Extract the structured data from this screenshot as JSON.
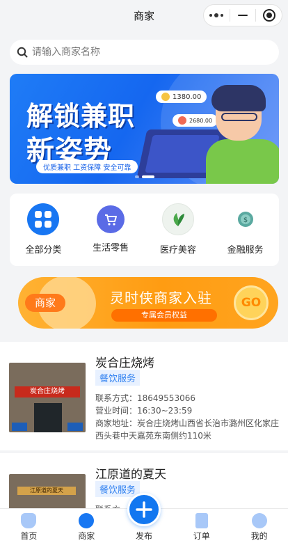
{
  "header": {
    "title": "商家"
  },
  "search": {
    "placeholder": "请输入商家名称"
  },
  "banner": {
    "headline1": "解锁兼职",
    "headline2": "新姿势",
    "tagline": "优质兼职 工资保障 安全可靠",
    "bubble1": "1380.00",
    "bubble2": "2680.00",
    "dots": 2,
    "active_dot": 2
  },
  "categories": [
    {
      "label": "全部分类",
      "icon": "grid-icon"
    },
    {
      "label": "生活零售",
      "icon": "cart-icon"
    },
    {
      "label": "医疗美容",
      "icon": "leaf-icon"
    },
    {
      "label": "金融服务",
      "icon": "coin-icon"
    }
  ],
  "join_banner": {
    "tag": "商家",
    "title": "灵时侠商家入驻",
    "subtitle": "专属会员权益",
    "go": "GO"
  },
  "merchants": [
    {
      "name": "炭合庄烧烤",
      "category": "餐饮服务",
      "contact": "联系方式：18649553066",
      "hours": "营业时间：16:30~23:59",
      "address": "商家地址：炭合庄烧烤山西省长治市潞州区化家庄西头巷中天嘉苑东南侧约110米",
      "photo_sign": "炭合庄烧烤"
    },
    {
      "name": "江原道的夏天",
      "category": "餐饮服务",
      "contact": "联系方",
      "photo_sign": "江原道的夏天"
    }
  ],
  "tabbar": [
    {
      "label": "首页",
      "icon": "home-icon"
    },
    {
      "label": "商家",
      "icon": "store-icon"
    },
    {
      "label": "发布",
      "icon": "plus-icon"
    },
    {
      "label": "订单",
      "icon": "order-icon"
    },
    {
      "label": "我的",
      "icon": "profile-icon"
    }
  ],
  "colors": {
    "primary": "#1277f0",
    "accent": "#ff9c12",
    "badge_bg": "#e8f1ff",
    "badge_text": "#2f80f0"
  }
}
